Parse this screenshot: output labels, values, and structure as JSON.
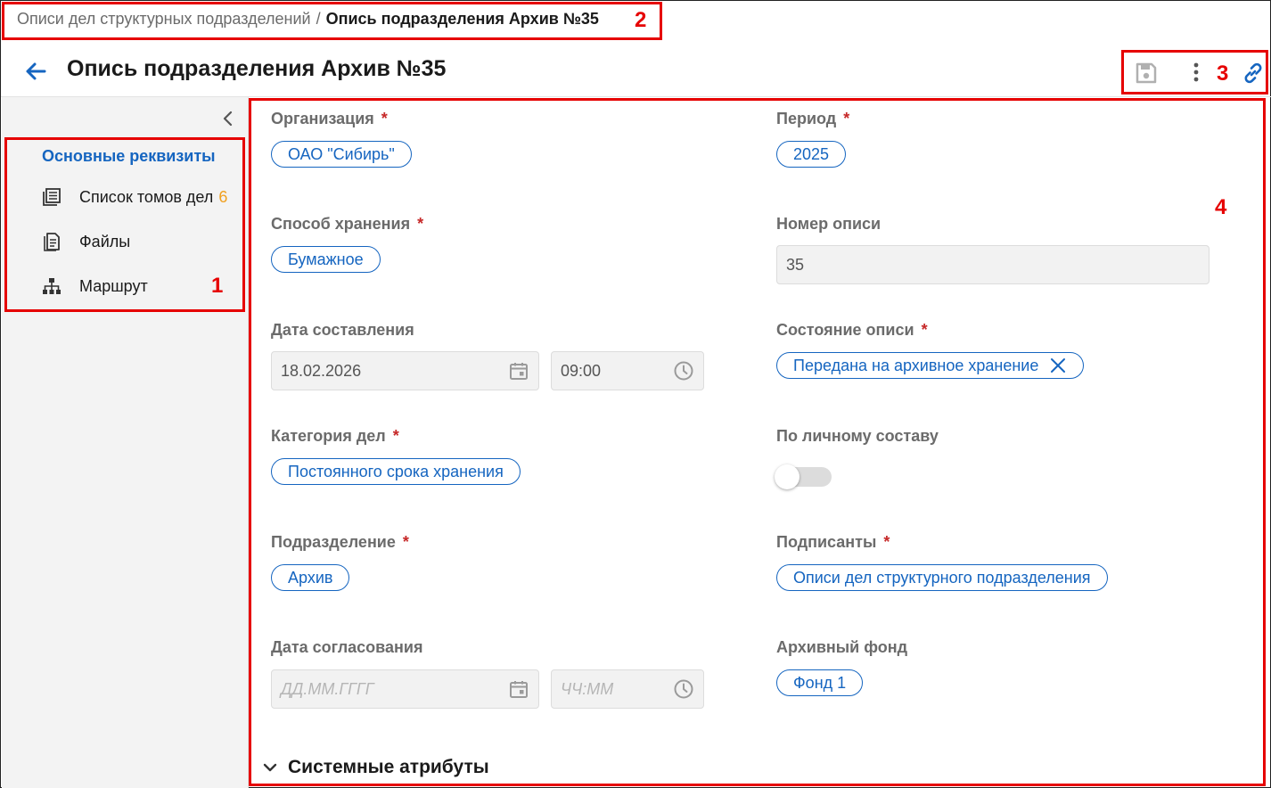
{
  "breadcrumb": {
    "parent": "Описи дел структурных подразделений",
    "separator": "/",
    "current": "Опись подразделения Архив №35"
  },
  "header": {
    "title": "Опись подразделения Архив №35"
  },
  "sidebar": {
    "active": "Основные реквизиты",
    "items": [
      {
        "label": "Список томов дел",
        "count": "6",
        "icon": "volumes-list-icon"
      },
      {
        "label": "Файлы",
        "icon": "file-document-icon"
      },
      {
        "label": "Маршрут",
        "icon": "route-hierarchy-icon"
      }
    ]
  },
  "form": {
    "organization": {
      "label": "Организация",
      "required": "*",
      "value": "ОАО \"Сибирь\""
    },
    "period": {
      "label": "Период",
      "required": "*",
      "value": "2025"
    },
    "storage_method": {
      "label": "Способ хранения",
      "required": "*",
      "value": "Бумажное"
    },
    "inventory_number": {
      "label": "Номер описи",
      "value": "35"
    },
    "compilation_date": {
      "label": "Дата составления",
      "date": "18.02.2026",
      "time": "09:00"
    },
    "inventory_state": {
      "label": "Состояние описи",
      "required": "*",
      "value": "Передана на архивное хранение"
    },
    "case_category": {
      "label": "Категория дел",
      "required": "*",
      "value": "Постоянного срока хранения"
    },
    "personnel": {
      "label": "По личному составу",
      "toggle_on": false
    },
    "department": {
      "label": "Подразделение",
      "required": "*",
      "value": "Архив"
    },
    "signers": {
      "label": "Подписанты",
      "required": "*",
      "value": "Описи дел структурного подразделения"
    },
    "approval_date": {
      "label": "Дата согласования",
      "date_placeholder": "ДД.ММ.ГГГГ",
      "time_placeholder": "ЧЧ:ММ"
    },
    "archive_fund": {
      "label": "Архивный фонд",
      "value": "Фонд 1"
    }
  },
  "system_section": {
    "label": "Системные атрибуты"
  },
  "annotations": [
    "1",
    "2",
    "3",
    "4"
  ],
  "colors": {
    "accent": "#1565c0",
    "required": "#c62828",
    "annotation": "#e60000",
    "count": "#f0a020"
  }
}
